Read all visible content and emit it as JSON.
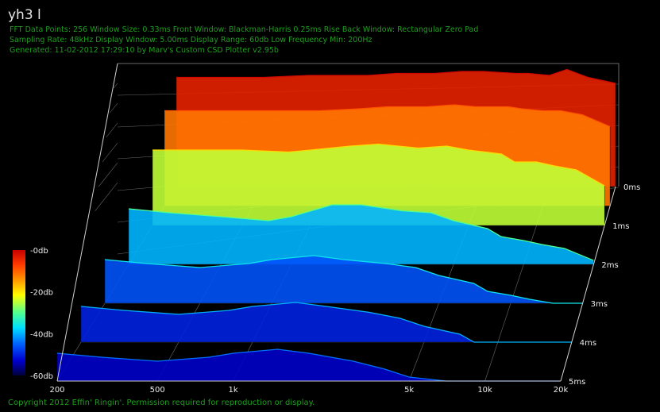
{
  "title": "yh3 l",
  "info": [
    "FFT Data Points: 256   Window Size: 0.33ms    Front Window: Blackman-Harris 0.25ms Rise    Back Window: Rectangular Zero Pad",
    "Sampling Rate: 48kHz   Display Window: 5.00ms    Display Range: 60db   Low Frequency Min: 200Hz",
    "Generated: 11-02-2012 17:29:10 by Marv's Custom CSD Plotter v2.95b"
  ],
  "footer": "Copyright 2012 Effin' Ringin'. Permission required for reproduction or display.",
  "colors": {
    "background": "#000000",
    "info_text": "#1e9e1e",
    "axis": "#d0d0d0",
    "grid": "#6a6a6a"
  },
  "chart_data": {
    "type": "waterfall",
    "x_scale": "log",
    "xlim": [
      200,
      20000
    ],
    "x_ticks": [
      "200",
      "500",
      "1k",
      "5k",
      "10k",
      "20k"
    ],
    "x_tick_values": [
      200,
      500,
      1000,
      5000,
      10000,
      20000
    ],
    "time_ticks": [
      "0ms",
      "1ms",
      "2ms",
      "3ms",
      "4ms",
      "5ms"
    ],
    "time_values": [
      0,
      1,
      2,
      3,
      4,
      5
    ],
    "z_range_db": [
      -60,
      0
    ],
    "colorbar_labels": [
      "-0db",
      "-20db",
      "-40db",
      "-60db"
    ],
    "colorbar_values": [
      0,
      -20,
      -40,
      -60
    ],
    "front_slice_db": {
      "freq": [
        200,
        300,
        500,
        800,
        1000,
        1500,
        2000,
        3000,
        4000,
        5000,
        7000,
        8000,
        10000,
        12000,
        15000,
        20000
      ],
      "db": [
        -5,
        -5,
        -5,
        -4,
        -4,
        -4,
        -3,
        -3,
        -2,
        -2,
        -3,
        -3,
        -4,
        -1,
        -5,
        -8
      ]
    },
    "decay_slices": [
      {
        "ms": 0.5,
        "db": [
          -12,
          -12,
          -12,
          -12,
          -12,
          -11,
          -10,
          -10,
          -9,
          -10,
          -10,
          -11,
          -12,
          -12,
          -14,
          -20
        ]
      },
      {
        "ms": 1.0,
        "db": [
          -22,
          -22,
          -22,
          -23,
          -22,
          -20,
          -19,
          -21,
          -20,
          -22,
          -24,
          -28,
          -28,
          -30,
          -32,
          -40
        ]
      },
      {
        "ms": 2.0,
        "db": [
          -32,
          -34,
          -36,
          -38,
          -36,
          -30,
          -30,
          -33,
          -34,
          -38,
          -42,
          -46,
          -48,
          -50,
          -52,
          -58
        ]
      },
      {
        "ms": 3.0,
        "db": [
          -38,
          -40,
          -42,
          -40,
          -38,
          -36,
          -38,
          -40,
          -42,
          -46,
          -50,
          -54,
          -56,
          -58,
          -60,
          -60
        ]
      },
      {
        "ms": 4.0,
        "db": [
          -42,
          -44,
          -46,
          -44,
          -42,
          -40,
          -42,
          -45,
          -48,
          -52,
          -56,
          -60,
          -60,
          -60,
          -60,
          -60
        ]
      },
      {
        "ms": 5.0,
        "db": [
          -46,
          -48,
          -50,
          -48,
          -46,
          -44,
          -46,
          -50,
          -54,
          -58,
          -60,
          -60,
          -60,
          -60,
          -60,
          -60
        ]
      }
    ]
  }
}
